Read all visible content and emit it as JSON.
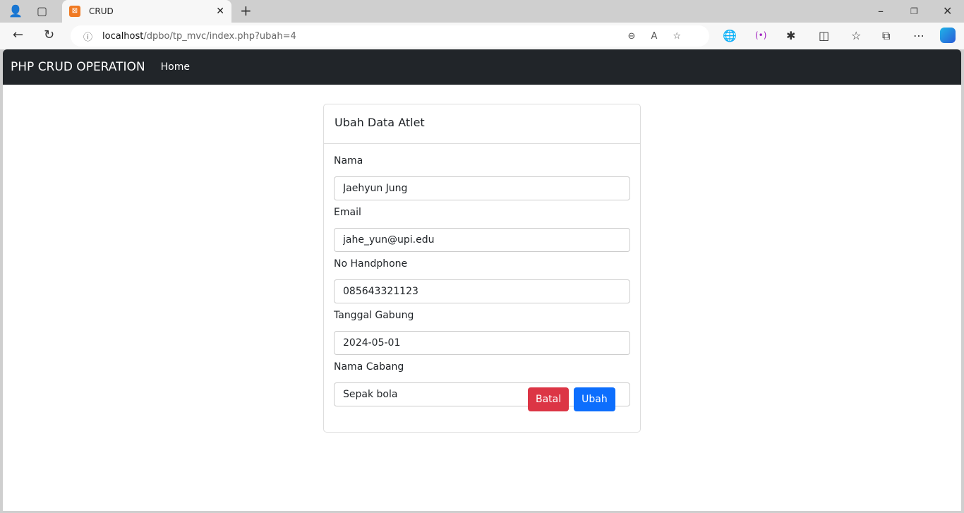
{
  "browser": {
    "tab_title": "CRUD",
    "url_host": "localhost",
    "url_path": "/dpbo/tp_mvc/index.php?ubah=4"
  },
  "navbar": {
    "brand": "PHP CRUD OPERATION",
    "home": "Home"
  },
  "form": {
    "title": "Ubah Data Atlet",
    "fields": [
      {
        "label": "Nama",
        "value": "Jaehyun Jung"
      },
      {
        "label": "Email",
        "value": "jahe_yun@upi.edu"
      },
      {
        "label": "No Handphone",
        "value": "085643321123"
      },
      {
        "label": "Tanggal Gabung",
        "value": "2024-05-01"
      },
      {
        "label": "Nama Cabang",
        "value": "Sepak bola"
      }
    ],
    "cancel_label": "Batal",
    "submit_label": "Ubah"
  },
  "colors": {
    "navbar": "#212529",
    "danger": "#dc3545",
    "primary": "#0d6efd"
  }
}
